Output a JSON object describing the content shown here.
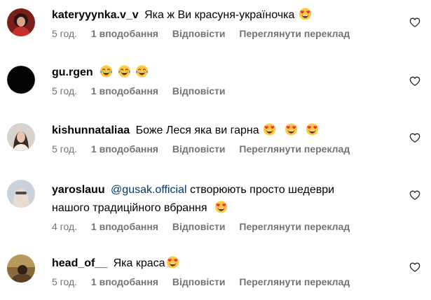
{
  "comments": [
    {
      "username": "kateryyynka.v_v",
      "text": "Яка ж Ви красуня-україночка",
      "emojis": [
        "heart-eyes"
      ],
      "time": "5 год.",
      "likes": "1 вподобання",
      "reply": "Відповісти",
      "translate": "Переглянути переклад"
    },
    {
      "username": "gu.rgen",
      "text": "",
      "emojis": [
        "tears-of-joy",
        "tears-of-joy",
        "tears-of-joy"
      ],
      "time": "5 год.",
      "likes": "1 вподобання",
      "reply": "Відповісти"
    },
    {
      "username": "kishunnataliaa",
      "text": "Боже Леся яка ви гарна",
      "emojis": [
        "heart-eyes",
        "heart-eyes",
        "heart-eyes"
      ],
      "time": "5 год.",
      "likes": "1 вподобання",
      "reply": "Відповісти",
      "translate": "Переглянути переклад"
    },
    {
      "username": "yaroslauu",
      "mention": "@gusak.official",
      "text_line1": "створюють просто шедеври",
      "text_line2": "нашого традиційного вбрання",
      "emojis": [
        "heart-eyes"
      ],
      "time": "4 год.",
      "likes": "1 вподобання",
      "reply": "Відповісти",
      "translate": "Переглянути переклад"
    },
    {
      "username": "head_of__",
      "text": "Яка краса",
      "emojis": [
        "heart-eyes"
      ],
      "time": "5 год.",
      "likes": "1 вподобання",
      "reply": "Відповісти",
      "translate": "Переглянути переклад"
    }
  ],
  "icons": {
    "like": "heart-outline-icon"
  },
  "colors": {
    "meta_text": "#737373",
    "mention": "#00376b",
    "emoji_face": "#ffc83d",
    "emoji_heart": "#f0284a"
  }
}
